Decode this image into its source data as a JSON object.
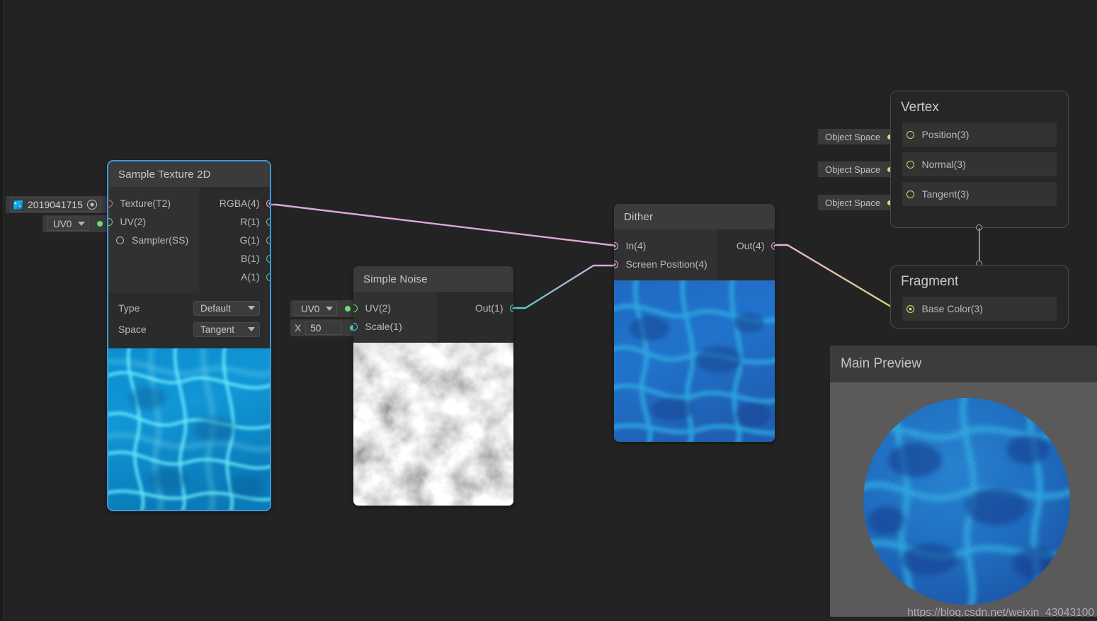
{
  "app": {
    "name": "Unity Shader Graph",
    "background_color": "#232323"
  },
  "properties": {
    "texture_property": {
      "name": "2019041715",
      "thumbnail_icon": "texture-thumbnail-icon",
      "picker_icon": "target-picker-icon",
      "port_color": "#d96f6f"
    },
    "uv_property": {
      "value": "UV0",
      "caret_icon": "chevron-down-icon",
      "port_color": "#6fd96f"
    }
  },
  "nodes": {
    "sample_texture_2d": {
      "title": "Sample Texture 2D",
      "selected": true,
      "inputs": [
        {
          "label": "Texture(T2)",
          "type": "texture",
          "connected": true
        },
        {
          "label": "UV(2)",
          "type": "uv",
          "connected": true
        },
        {
          "label": "Sampler(SS)",
          "type": "sampler",
          "connected": false
        }
      ],
      "outputs": [
        {
          "label": "RGBA(4)",
          "type": "vec4",
          "connected": true
        },
        {
          "label": "R(1)",
          "type": "float",
          "connected": false
        },
        {
          "label": "G(1)",
          "type": "float",
          "connected": false
        },
        {
          "label": "B(1)",
          "type": "float",
          "connected": false
        },
        {
          "label": "A(1)",
          "type": "float",
          "connected": false
        }
      ],
      "settings": [
        {
          "key": "Type",
          "value": "Default"
        },
        {
          "key": "Space",
          "value": "Tangent"
        }
      ],
      "preview": "caustic-water-texture"
    },
    "simple_noise": {
      "title": "Simple Noise",
      "selected": false,
      "inputs": [
        {
          "label": "UV(2)",
          "type": "uv",
          "connected": true
        },
        {
          "label": "Scale(1)",
          "type": "float",
          "connected": true
        }
      ],
      "outputs": [
        {
          "label": "Out(1)",
          "type": "float",
          "connected": true
        }
      ],
      "preview": "grayscale-noise",
      "input_widgets": {
        "uv_dropdown": "UV0",
        "scale_axis_label": "X",
        "scale_value": "50"
      }
    },
    "dither": {
      "title": "Dither",
      "selected": false,
      "inputs": [
        {
          "label": "In(4)",
          "type": "vec4",
          "connected": true
        },
        {
          "label": "Screen Position(4)",
          "type": "vec4",
          "connected": true
        }
      ],
      "outputs": [
        {
          "label": "Out(4)",
          "type": "vec4",
          "connected": true
        }
      ],
      "preview": "dithered-caustic"
    }
  },
  "masters": {
    "vertex": {
      "title": "Vertex",
      "slots": [
        {
          "label": "Position(3)",
          "space": "Object Space",
          "connected": false
        },
        {
          "label": "Normal(3)",
          "space": "Object Space",
          "connected": false
        },
        {
          "label": "Tangent(3)",
          "space": "Object Space",
          "connected": false
        }
      ]
    },
    "fragment": {
      "title": "Fragment",
      "slots": [
        {
          "label": "Base Color(3)",
          "connected": true
        }
      ]
    }
  },
  "main_preview": {
    "title": "Main Preview",
    "watermark": "https://blog.csdn.net/weixin_43043100",
    "shape": "sphere",
    "background_color": "#5a5a5a"
  },
  "colors": {
    "vec4_port": "#e0a6da",
    "float_port": "#5bc8c8",
    "texture_port": "#d96f6f",
    "uv_port": "#6fd96f",
    "sampler_port": "#bdbdbd",
    "vertex_port": "#d6d96f",
    "selection_border": "#3d9ad6",
    "node_body": "#2b2b2b",
    "node_header": "#3b3b3b",
    "canvas": "#232323"
  },
  "edges": [
    {
      "from": "texture_property",
      "to": "sample_texture_2d.Texture(T2)",
      "color_start": "#d96f6f",
      "color_end": "#d96f6f"
    },
    {
      "from": "uv_property",
      "to": "sample_texture_2d.UV(2)",
      "color_start": "#6fd96f",
      "color_end": "#6fd96f"
    },
    {
      "from": "sample_texture_2d.RGBA(4)",
      "to": "dither.In(4)",
      "color_start": "#e0a6da",
      "color_end": "#e0a6da"
    },
    {
      "from": "simple_noise.Out(1)",
      "to": "dither.Screen Position(4)",
      "color_start": "#5bc8c8",
      "color_end": "#e0a6da"
    },
    {
      "from": "dither.Out(4)",
      "to": "fragment.Base Color(3)",
      "color_start": "#e0a6da",
      "color_end": "#d6d96f"
    },
    {
      "from": "noise_uv_property",
      "to": "simple_noise.UV(2)",
      "color_start": "#6fd96f",
      "color_end": "#6fd96f"
    },
    {
      "from": "noise_scale_property",
      "to": "simple_noise.Scale(1)",
      "color_start": "#5bc8c8",
      "color_end": "#5bc8c8"
    }
  ]
}
